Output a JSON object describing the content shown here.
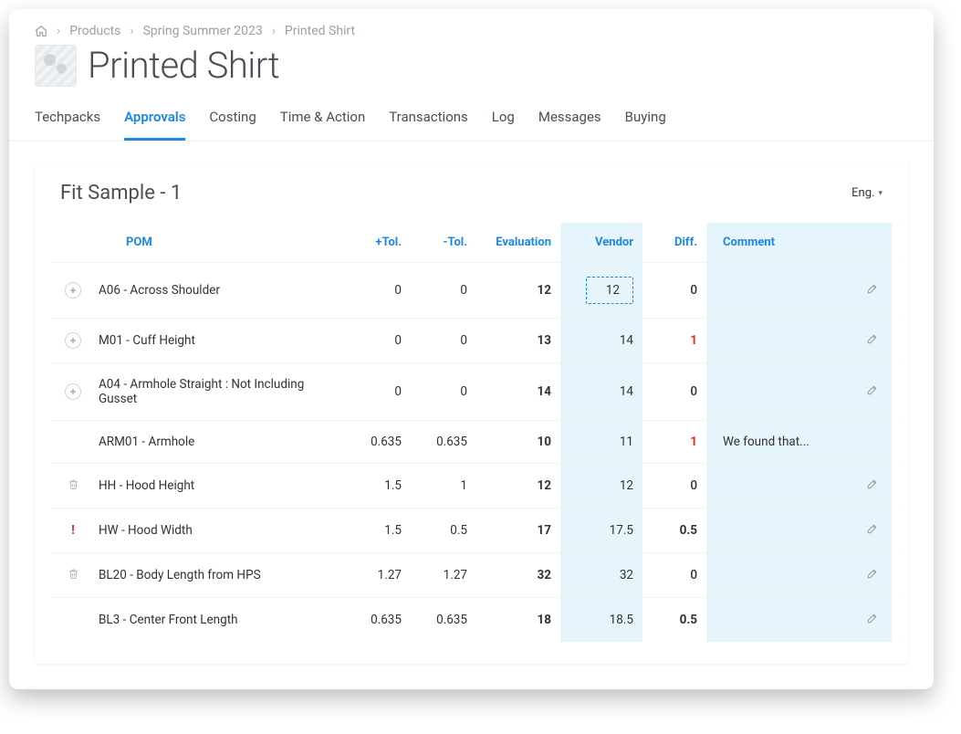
{
  "breadcrumb": {
    "items": [
      "Products",
      "Spring Summer 2023",
      "Printed Shirt"
    ]
  },
  "page": {
    "title": "Printed Shirt"
  },
  "tabs": {
    "items": [
      "Techpacks",
      "Approvals",
      "Costing",
      "Time & Action",
      "Transactions",
      "Log",
      "Messages",
      "Buying"
    ],
    "active_index": 1
  },
  "panel": {
    "title": "Fit Sample - 1",
    "lang_label": "Eng."
  },
  "table": {
    "headers": {
      "pom": "POM",
      "ptol": "+Tol.",
      "ntol": "-Tol.",
      "evaluation": "Evaluation",
      "vendor": "Vendor",
      "diff": "Diff.",
      "comment": "Comment"
    },
    "rows": [
      {
        "icon": "expand",
        "pom": "A06 - Across Shoulder",
        "ptol": "0",
        "ntol": "0",
        "evaluation": "12",
        "vendor": "12",
        "vendor_editing": true,
        "diff": "0",
        "diff_state": "ok",
        "comment": "",
        "editable": true
      },
      {
        "icon": "expand",
        "pom": "M01 - Cuff Height",
        "ptol": "0",
        "ntol": "0",
        "evaluation": "13",
        "vendor": "14",
        "diff": "1",
        "diff_state": "bad",
        "comment": "",
        "editable": true
      },
      {
        "icon": "expand",
        "pom": "A04 - Armhole Straight : Not Including Gusset",
        "ptol": "0",
        "ntol": "0",
        "evaluation": "14",
        "vendor": "14",
        "diff": "0",
        "diff_state": "ok",
        "comment": "",
        "editable": true
      },
      {
        "icon": "none",
        "pom": "ARM01 - Armhole",
        "ptol": "0.635",
        "ntol": "0.635",
        "evaluation": "10",
        "vendor": "11",
        "diff": "1",
        "diff_state": "bad",
        "comment": "We found that...",
        "editable": false
      },
      {
        "icon": "trash",
        "pom": "HH - Hood Height",
        "ptol": "1.5",
        "ntol": "1",
        "evaluation": "12",
        "vendor": "12",
        "diff": "0",
        "diff_state": "ok",
        "comment": "",
        "editable": true
      },
      {
        "icon": "warn",
        "pom": "HW - Hood Width",
        "ptol": "1.5",
        "ntol": "0.5",
        "evaluation": "17",
        "vendor": "17.5",
        "diff": "0.5",
        "diff_state": "emph",
        "comment": "",
        "editable": true
      },
      {
        "icon": "trash",
        "pom": "BL20 - Body Length from HPS",
        "ptol": "1.27",
        "ntol": "1.27",
        "evaluation": "32",
        "vendor": "32",
        "diff": "0",
        "diff_state": "ok",
        "comment": "",
        "editable": true
      },
      {
        "icon": "none",
        "pom": "BL3 - Center Front Length",
        "ptol": "0.635",
        "ntol": "0.635",
        "evaluation": "18",
        "vendor": "18.5",
        "diff": "0.5",
        "diff_state": "emph",
        "comment": "",
        "editable": true
      }
    ]
  }
}
